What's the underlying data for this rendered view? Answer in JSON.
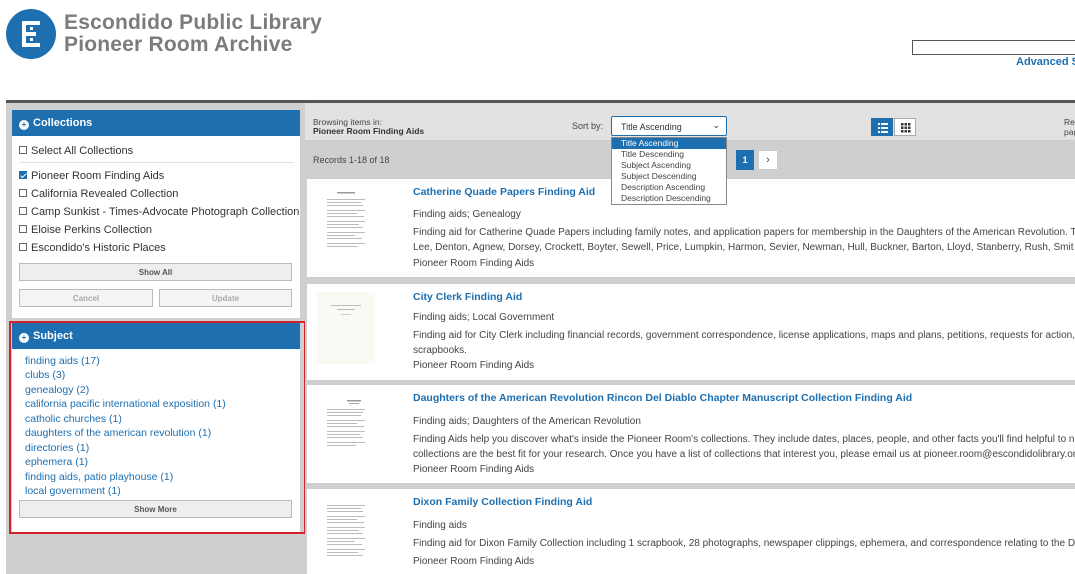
{
  "header": {
    "brand_line1": "Escondido Public Library",
    "brand_line2": "Pioneer Room Archive",
    "advanced_search": "Advanced Se"
  },
  "collections": {
    "title": "Collections",
    "select_all": "Select All Collections",
    "items": [
      {
        "label": "Pioneer Room Finding Aids",
        "checked": true
      },
      {
        "label": "California Revealed Collection",
        "checked": false
      },
      {
        "label": "Camp Sunkist - Times-Advocate Photograph Collection",
        "checked": false
      },
      {
        "label": "Eloise Perkins Collection",
        "checked": false
      },
      {
        "label": "Escondido's Historic Places",
        "checked": false
      }
    ],
    "show_all": "Show All",
    "cancel": "Cancel",
    "update": "Update"
  },
  "subject": {
    "title": "Subject",
    "items": [
      "finding aids (17)",
      "clubs (3)",
      "genealogy (2)",
      "california pacific international exposition (1)",
      "catholic churches (1)",
      "daughters of the american revolution (1)",
      "directories (1)",
      "ephemera (1)",
      "finding aids, patio playhouse (1)",
      "local government (1)"
    ],
    "show_more": "Show More"
  },
  "toolbar": {
    "browsing_label": "Browsing items in:",
    "browsing_value": "Pioneer Room Finding Aids",
    "sort_label": "Sort by:",
    "sort_value": "Title Ascending",
    "sort_options": [
      "Title Ascending",
      "Title Descending",
      "Subject Ascending",
      "Subject Descending",
      "Description Ascending",
      "Description Descending"
    ],
    "re_line1": "Re",
    "re_line2": "pag"
  },
  "results": {
    "records": "Records 1-18 of 18",
    "current_page": "1",
    "next": "›",
    "items": [
      {
        "title": "Catherine Quade Papers Finding Aid",
        "subject": "Finding aids; Genealogy",
        "desc1": "Finding aid for Catherine Quade Papers including family notes, and application papers for membership in the Daughters of the American Revolution. T",
        "desc2": "Lee, Denton, Agnew, Dorsey, Crockett, Boyter, Sewell, Price, Lumpkin, Harmon, Sevier, Newman, Hull, Buckner, Barton, Lloyd, Stanberry, Rush, Smit",
        "collection": "Pioneer Room Finding Aids"
      },
      {
        "title": "City Clerk Finding Aid",
        "subject": "Finding aids; Local Government",
        "desc1": "Finding aid for City Clerk including financial records, government correspondence, license applications, maps and plans, petitions, requests for action,",
        "desc2": "scrapbooks.",
        "collection": "Pioneer Room Finding Aids"
      },
      {
        "title": "Daughters of the American Revolution Rincon Del Diablo Chapter Manuscript Collection Finding Aid",
        "subject": "Finding aids; Daughters of the American Revolution",
        "desc1": "Finding Aids help you discover what's inside the Pioneer Room's collections. They include dates, places, people, and other facts you'll find helpful to n",
        "desc2": "collections are the best fit for your research. Once you have a list of collections that interest you, please email us at pioneer.room@escondidolibrary.or",
        "collection": "Pioneer Room Finding Aids"
      },
      {
        "title": "Dixon Family Collection Finding Aid",
        "subject": "Finding aids",
        "desc1": "Finding aid for Dixon Family Collection including 1 scrapbook, 28 photographs, newspaper clippings, ephemera, and correspondence relating to the D",
        "desc2": "",
        "collection": "Pioneer Room Finding Aids"
      }
    ]
  }
}
